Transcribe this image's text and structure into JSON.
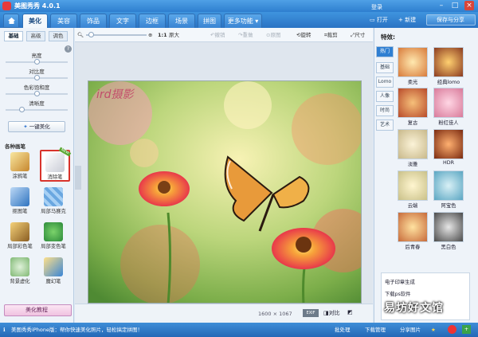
{
  "app": {
    "title": "美图秀秀 4.0.1"
  },
  "tabs": [
    "美化",
    "美容",
    "饰品",
    "文字",
    "边框",
    "场景",
    "拼图",
    "更多功能 ▾"
  ],
  "topright": {
    "login": "登录",
    "open": "打开",
    "new": "新建",
    "save": "保存与分享"
  },
  "left": {
    "subtabs": [
      "基础",
      "高级",
      "调色"
    ],
    "sliders": [
      {
        "label": "亮度",
        "level": 0.5
      },
      {
        "label": "对比度",
        "level": 0.5
      },
      {
        "label": "色彩饱和度",
        "level": 0.5
      },
      {
        "label": "清晰度",
        "level": 0.25
      }
    ],
    "onekey": "一键美化",
    "section_title": "各种画笔",
    "tools": [
      "涂鸦笔",
      "消除笔",
      "抠图笔",
      "局部马赛克",
      "局部彩色笔",
      "局部变色笔",
      "背景虚化",
      "魔幻笔"
    ],
    "new_badge": "NEW",
    "beauty_btn": "美化教程"
  },
  "toolbar": {
    "zoom_actual": "1:1",
    "zoom_orig": "原大",
    "undo": "撤销",
    "redo": "重做",
    "restore": "原图",
    "rotate": "旋转",
    "crop": "裁剪",
    "size": "尺寸"
  },
  "canvas": {
    "overlay_text": "ird摄影"
  },
  "status": {
    "dims": "1600 × 1067",
    "compare": "对比"
  },
  "right": {
    "title": "特效:",
    "tabs": [
      "热门",
      "基础",
      "Lomo",
      "人像",
      "时尚",
      "艺术"
    ],
    "effects": [
      "柔光",
      "经典lomo",
      "复古",
      "粉红佳人",
      "淡雅",
      "HDR",
      "云端",
      "阿宝色",
      "后青春",
      "黑白色"
    ],
    "links": [
      "电子印章生成",
      "下载ps软件"
    ]
  },
  "bottom": {
    "promo": "美图秀秀iPhone版：帮你快速美化照片，轻松搞定拼图！",
    "batch": "批处理",
    "download": "下载管理",
    "share": "分享图片"
  },
  "watermark": "易坊好文馆"
}
